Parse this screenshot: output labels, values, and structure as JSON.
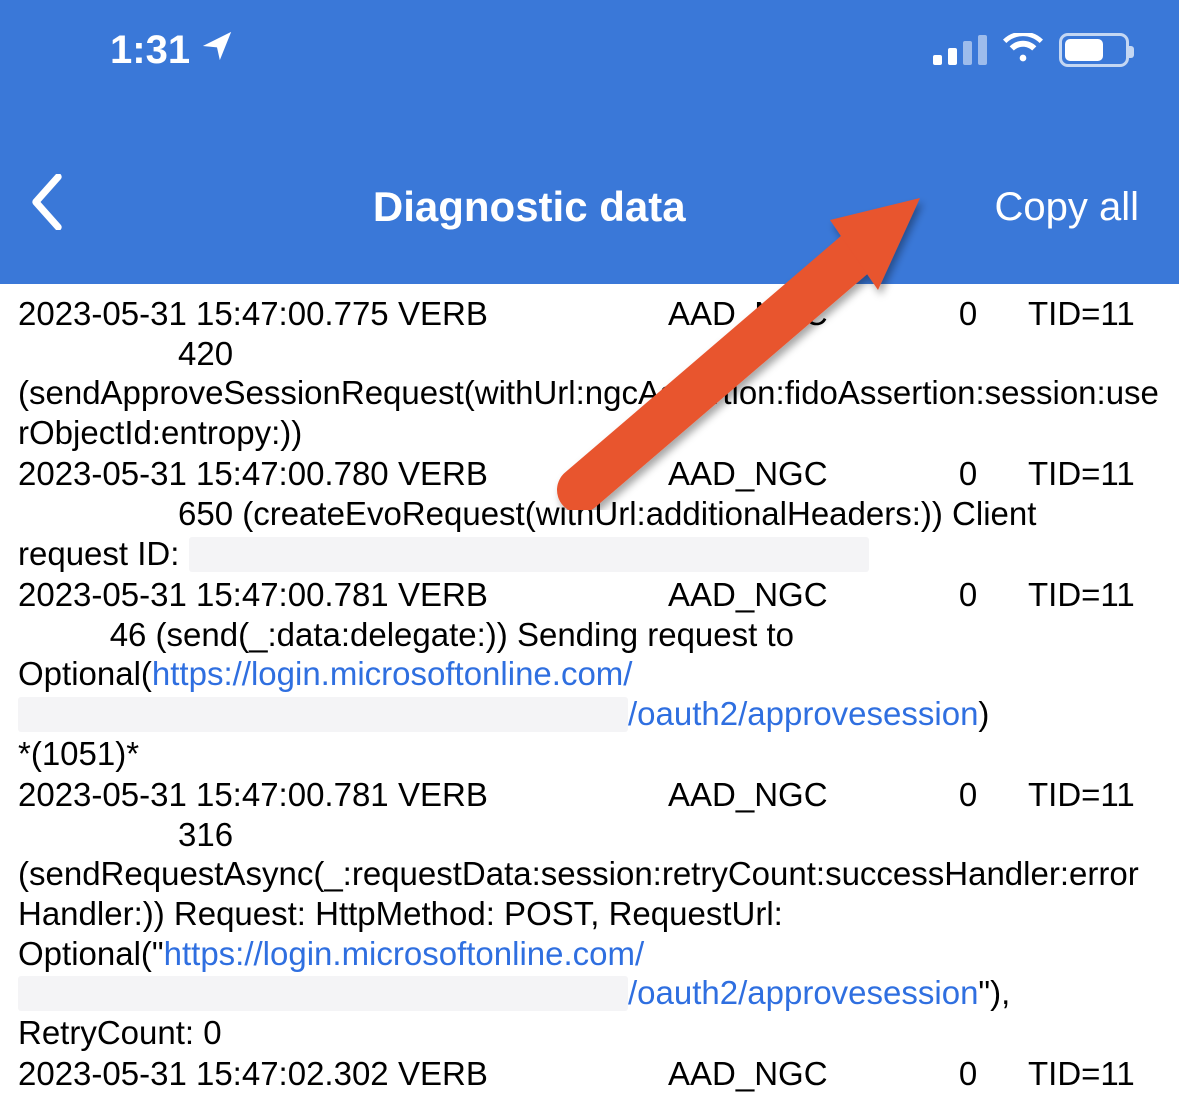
{
  "status": {
    "time": "1:31",
    "location_icon": "location-arrow-icon",
    "signal_active_bars": 2,
    "wifi_icon": "wifi-icon",
    "battery_icon": "battery-icon"
  },
  "nav": {
    "back_icon": "chevron-left-icon",
    "title": "Diagnostic data",
    "copy_all": "Copy all"
  },
  "logs": [
    {
      "ts": "2023-05-31 15:47:00.775",
      "level": "VERB",
      "tag": "AAD_NGC",
      "zero": "0",
      "tid": "TID=11",
      "line1": "420",
      "body": "(sendApproveSessionRequest(withUrl:ngcAssertion:fidoAssertion:session:userObjectId:entropy:))"
    },
    {
      "ts": "2023-05-31 15:47:00.780",
      "level": "VERB",
      "tag": "AAD_NGC",
      "zero": "0",
      "tid": "TID=11",
      "line1_prefix": "650 (createEvoRequest(withUrl:additionalHeaders:)) Client",
      "line2_prefix": "request ID: "
    },
    {
      "ts": "2023-05-31 15:47:00.781",
      "level": "VERB",
      "tag": "AAD_NGC",
      "zero": "0",
      "tid": "TID=11",
      "line1_prefix": "46 (send(_:data:delegate:)) Sending request to Optional(",
      "link1": "https://login.microsoftonline.com/",
      "link2": "/oauth2/approvesession",
      "suffix": ")",
      "extra": "*(1051)*"
    },
    {
      "ts": "2023-05-31 15:47:00.781",
      "level": "VERB",
      "tag": "AAD_NGC",
      "zero": "0",
      "tid": "TID=11",
      "line1": "316",
      "body_prefix": "(sendRequestAsync(_:requestData:session:retryCount:successHandler:errorHandler:)) Request: HttpMethod: POST, RequestUrl: Optional(\"",
      "link1": "https://login.microsoftonline.com/",
      "link2": "/oauth2/approvesession",
      "body_suffix": "\"), RetryCount: 0"
    },
    {
      "ts": "2023-05-31 15:47:02.302",
      "level": "VERB",
      "tag": "AAD_NGC",
      "zero": "0",
      "tid": "TID=11"
    }
  ],
  "annotation": {
    "arrow_color": "#e8542f"
  }
}
